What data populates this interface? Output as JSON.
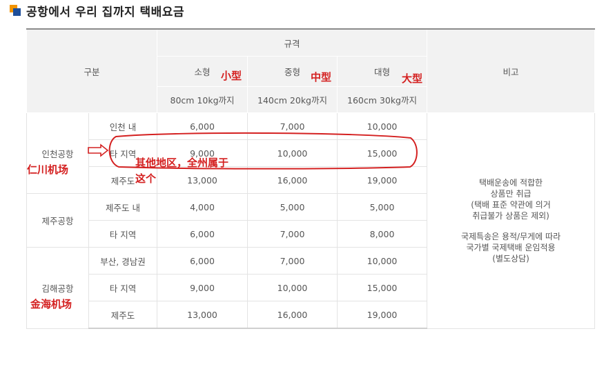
{
  "title": "공항에서 우리 집까지 택배요금",
  "header": {
    "category": "구분",
    "spec": "규격",
    "remarks": "비고",
    "sizes": [
      {
        "label": "소형",
        "limit": "80cm 10kg까지"
      },
      {
        "label": "중형",
        "limit": "140cm 20kg까지"
      },
      {
        "label": "대형",
        "limit": "160cm 30kg까지"
      }
    ]
  },
  "airports": [
    {
      "name": "인천공항",
      "rows": [
        {
          "area": "인천 내",
          "small": "6,000",
          "medium": "7,000",
          "large": "10,000"
        },
        {
          "area": "타 지역",
          "small": "9,000",
          "medium": "10,000",
          "large": "15,000"
        },
        {
          "area": "제주도",
          "small": "13,000",
          "medium": "16,000",
          "large": "19,000"
        }
      ]
    },
    {
      "name": "제주공항",
      "rows": [
        {
          "area": "제주도 내",
          "small": "4,000",
          "medium": "5,000",
          "large": "5,000"
        },
        {
          "area": "타 지역",
          "small": "6,000",
          "medium": "7,000",
          "large": "8,000"
        }
      ]
    },
    {
      "name": "김해공항",
      "rows": [
        {
          "area": "부산, 경남권",
          "small": "6,000",
          "medium": "7,000",
          "large": "10,000"
        },
        {
          "area": "타 지역",
          "small": "9,000",
          "medium": "10,000",
          "large": "15,000"
        },
        {
          "area": "제주도",
          "small": "13,000",
          "medium": "16,000",
          "large": "19,000"
        }
      ]
    }
  ],
  "remarks_text": {
    "line1": "택배운송에 적합한",
    "line2": "상품만 취급",
    "line3": "(택배 표준 약관에 의거",
    "line4": "취급불가 상품은 제외)",
    "line5": "국제특송은 용적/무게에 따라",
    "line6": "국가별 국제택배 운임적용",
    "line7": "(별도상담)"
  },
  "annotations": {
    "small": "小型",
    "medium": "中型",
    "large": "大型",
    "incheon": "仁川机场",
    "gimhae": "金海机场",
    "other_regions": "其他地区，全州属于",
    "this_one": "这个",
    "color": "#d42020"
  }
}
